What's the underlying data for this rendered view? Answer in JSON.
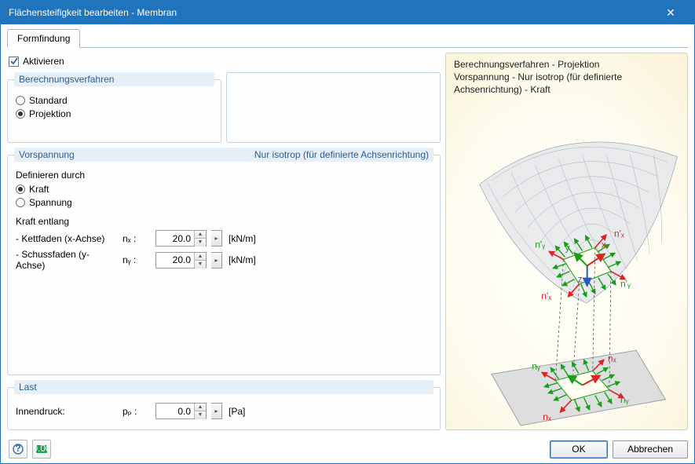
{
  "window": {
    "title": "Flächensteifigkeit bearbeiten - Membran",
    "close": "✕"
  },
  "tabs": {
    "formfinding": "Formfindung"
  },
  "activate": {
    "label": "Aktivieren",
    "checked": true
  },
  "method": {
    "heading": "Berechnungsverfahren",
    "standard": "Standard",
    "projection": "Projektion",
    "selected": "projection"
  },
  "prestress": {
    "heading": "Vorspannung",
    "subheading": "Nur isotrop (für definierte Achsenrichtung)",
    "defineBy": "Definieren durch",
    "force": "Kraft",
    "stress": "Spannung",
    "selected": "force",
    "alongHeading": "Kraft entlang",
    "warp": {
      "label": "- Kettfaden (x-Achse)",
      "symbol": "nₓ :",
      "value": "20.0",
      "unit": "[kN/m]"
    },
    "weft": {
      "label": "- Schussfaden (y-Achse)",
      "symbol": "nᵧ :",
      "value": "20.0",
      "unit": "[kN/m]"
    }
  },
  "load": {
    "heading": "Last",
    "pressureLabel": "Innendruck:",
    "pressureSymbol": "pₚ :",
    "pressureValue": "0.0",
    "pressureUnit": "[Pa]"
  },
  "preview": {
    "line1": "Berechnungsverfahren - Projektion",
    "line2": "Vorspannung - Nur isotrop (für definierte Achsenrichtung) - Kraft",
    "labels": {
      "nx": "nₓ",
      "ny": "nᵧ",
      "npx": "n'ₓ",
      "npy": "n'ᵧ",
      "x": "x",
      "y": "y",
      "z": "z"
    }
  },
  "footer": {
    "ok": "OK",
    "cancel": "Abbrechen"
  }
}
